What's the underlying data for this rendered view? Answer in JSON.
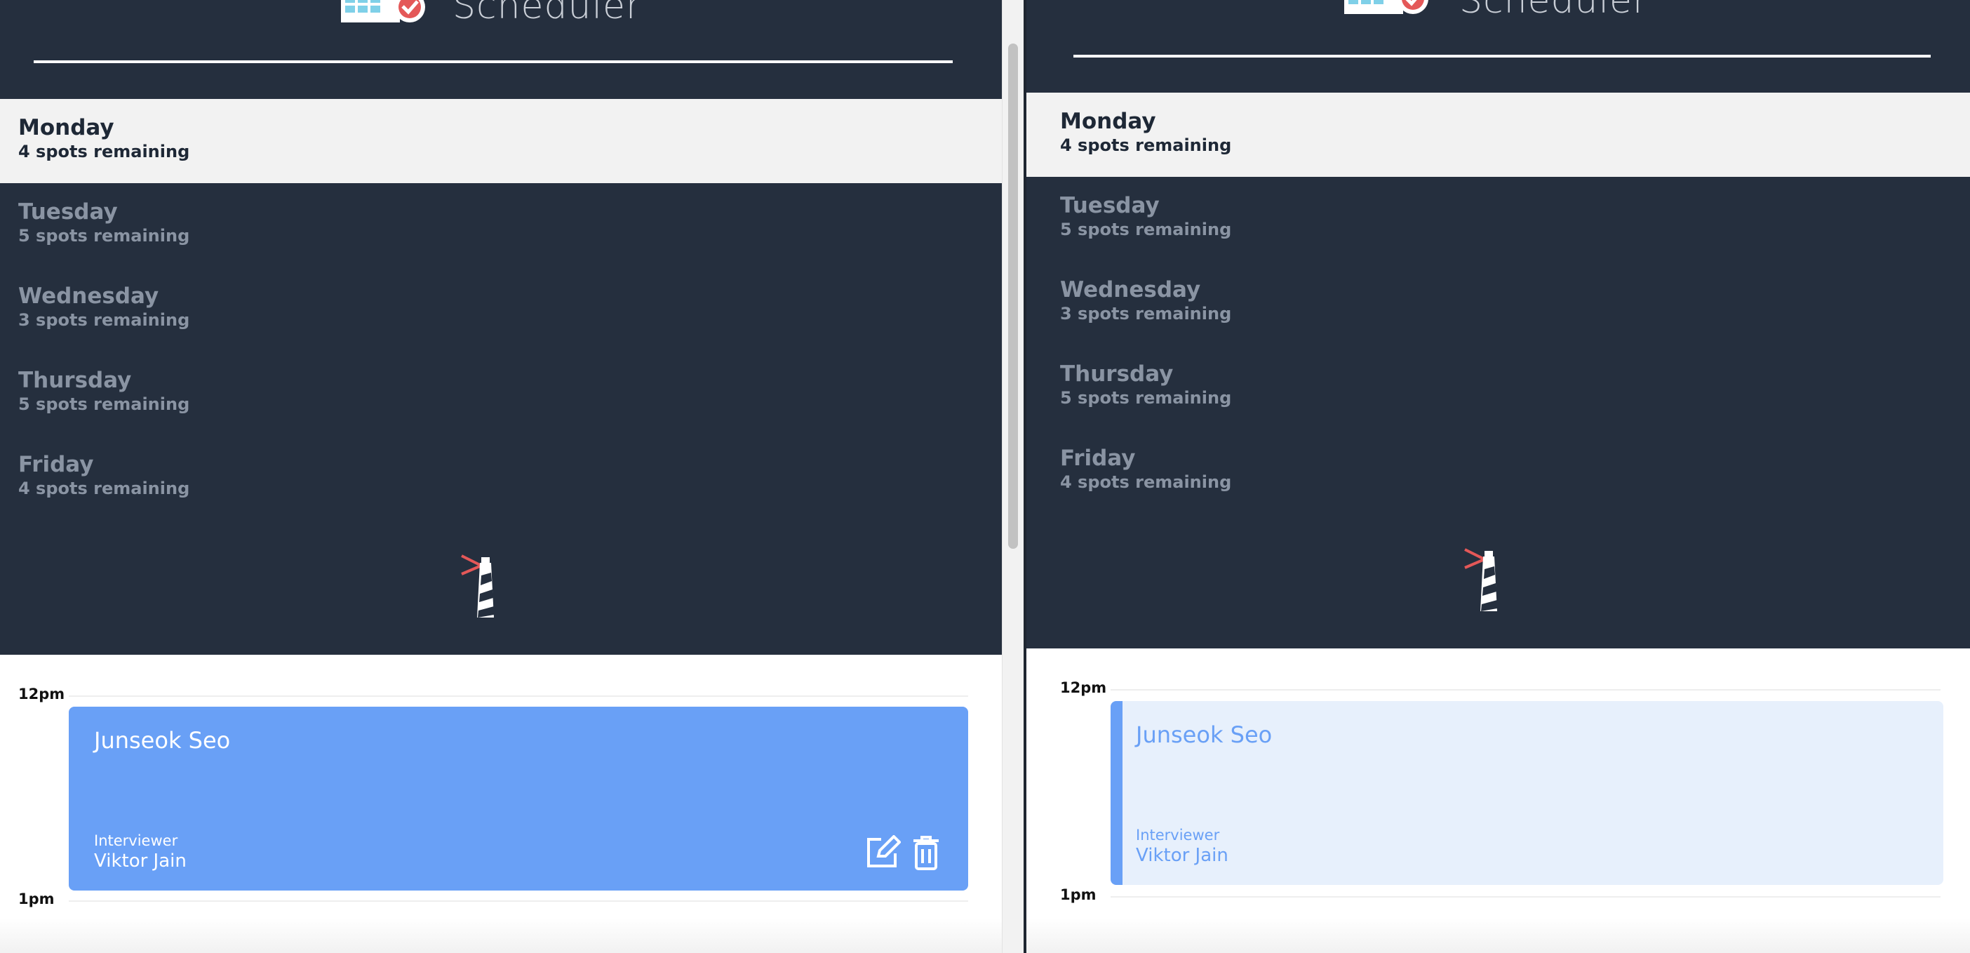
{
  "app": {
    "brand": "Scheduler"
  },
  "days": [
    {
      "name": "Monday",
      "spots": "4 spots remaining",
      "active": true
    },
    {
      "name": "Tuesday",
      "spots": "5 spots remaining",
      "active": false
    },
    {
      "name": "Wednesday",
      "spots": "3 spots remaining",
      "active": false
    },
    {
      "name": "Thursday",
      "spots": "5 spots remaining",
      "active": false
    },
    {
      "name": "Friday",
      "spots": "4 spots remaining",
      "active": false
    }
  ],
  "schedule": {
    "hours": [
      "12pm",
      "1pm"
    ],
    "appointment": {
      "student": "Junseok Seo",
      "role_label": "Interviewer",
      "interviewer": "Viktor Jain"
    }
  },
  "colors": {
    "nav_bg": "#252f3e",
    "active_day_bg": "#f2f2f2",
    "appointment_blue": "#69a0f6",
    "appointment_light": "#e7f0fc",
    "accent_red": "#e45858"
  },
  "icons": [
    "calendar-check-icon",
    "lighthouse-logo-icon",
    "edit-icon",
    "trash-icon"
  ]
}
